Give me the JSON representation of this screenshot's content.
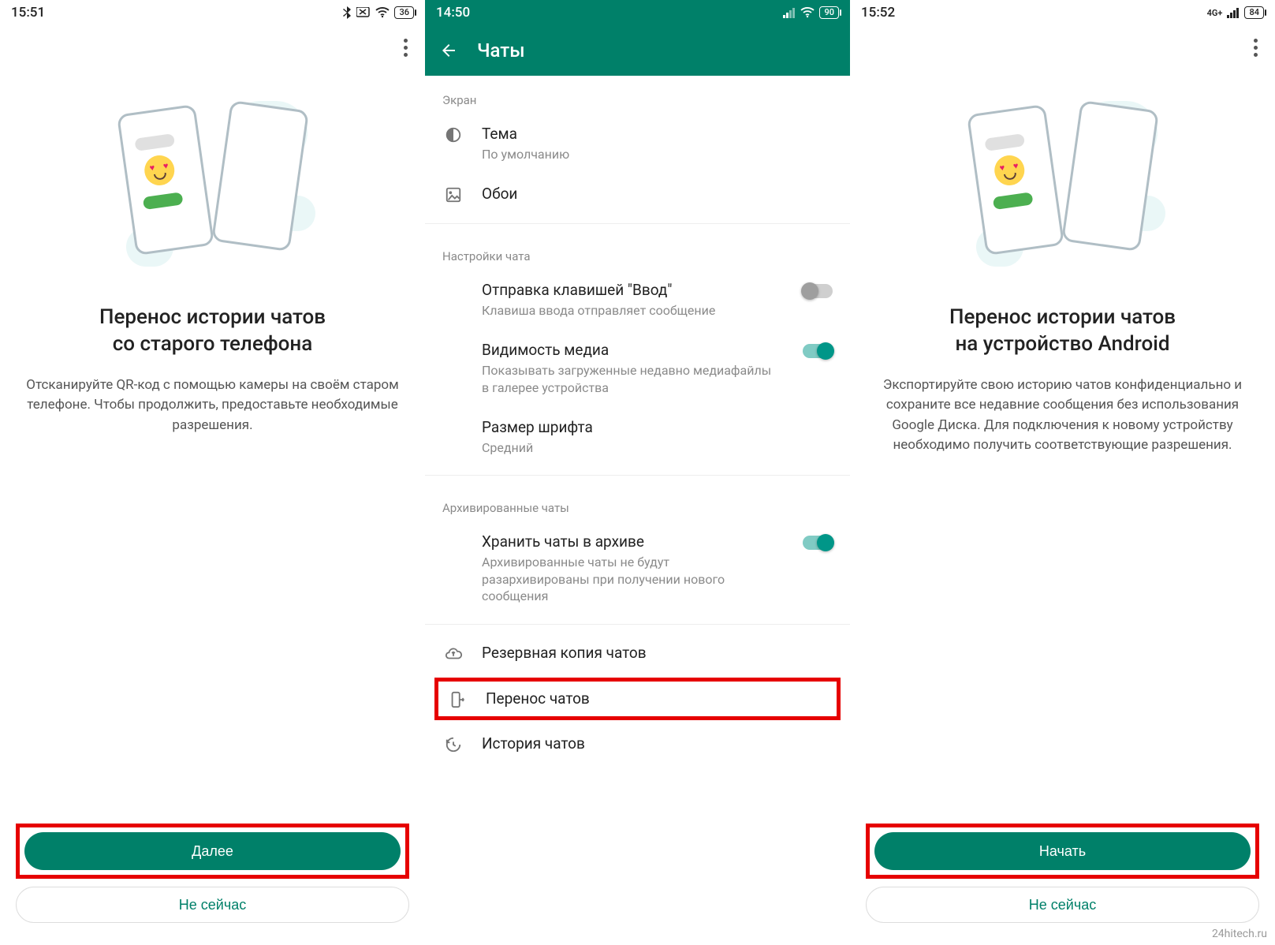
{
  "watermark": "24hitech.ru",
  "screen1": {
    "status": {
      "time": "15:51",
      "battery": "36"
    },
    "headline_l1": "Перенос истории чатов",
    "headline_l2": "со старого телефона",
    "body": "Отсканируйте QR-код с помощью камеры на своём старом телефоне. Чтобы продолжить, предоставьте необходимые разрешения.",
    "primary_btn": "Далее",
    "secondary_btn": "Не сейчас"
  },
  "screen2": {
    "status": {
      "time": "14:50",
      "battery": "90"
    },
    "title": "Чаты",
    "sections": {
      "display": "Экран",
      "chat": "Настройки чата",
      "archive": "Архивированные чаты"
    },
    "items": {
      "theme": {
        "title": "Тема",
        "sub": "По умолчанию"
      },
      "wallpaper": {
        "title": "Обои"
      },
      "enter": {
        "title": "Отправка клавишей \"Ввод\"",
        "sub": "Клавиша ввода отправляет сообщение"
      },
      "media": {
        "title": "Видимость медиа",
        "sub": "Показывать загруженные недавно медиафайлы в галерее устройства"
      },
      "fontsize": {
        "title": "Размер шрифта",
        "sub": "Средний"
      },
      "keep_archived": {
        "title": "Хранить чаты в архиве",
        "sub": "Архивированные чаты не будут разархивированы при получении нового сообщения"
      },
      "backup": {
        "title": "Резервная копия чатов"
      },
      "transfer": {
        "title": "Перенос чатов"
      },
      "history": {
        "title": "История чатов"
      }
    }
  },
  "screen3": {
    "status": {
      "time": "15:52",
      "battery": "84",
      "network": "4G+"
    },
    "headline_l1": "Перенос истории чатов",
    "headline_l2": "на устройство Android",
    "body": "Экспортируйте свою историю чатов конфиденциально и сохраните все недавние сообщения без использования Google Диска. Для подключения к новому устройству необходимо получить соответствующие разрешения.",
    "primary_btn": "Начать",
    "secondary_btn": "Не сейчас"
  }
}
